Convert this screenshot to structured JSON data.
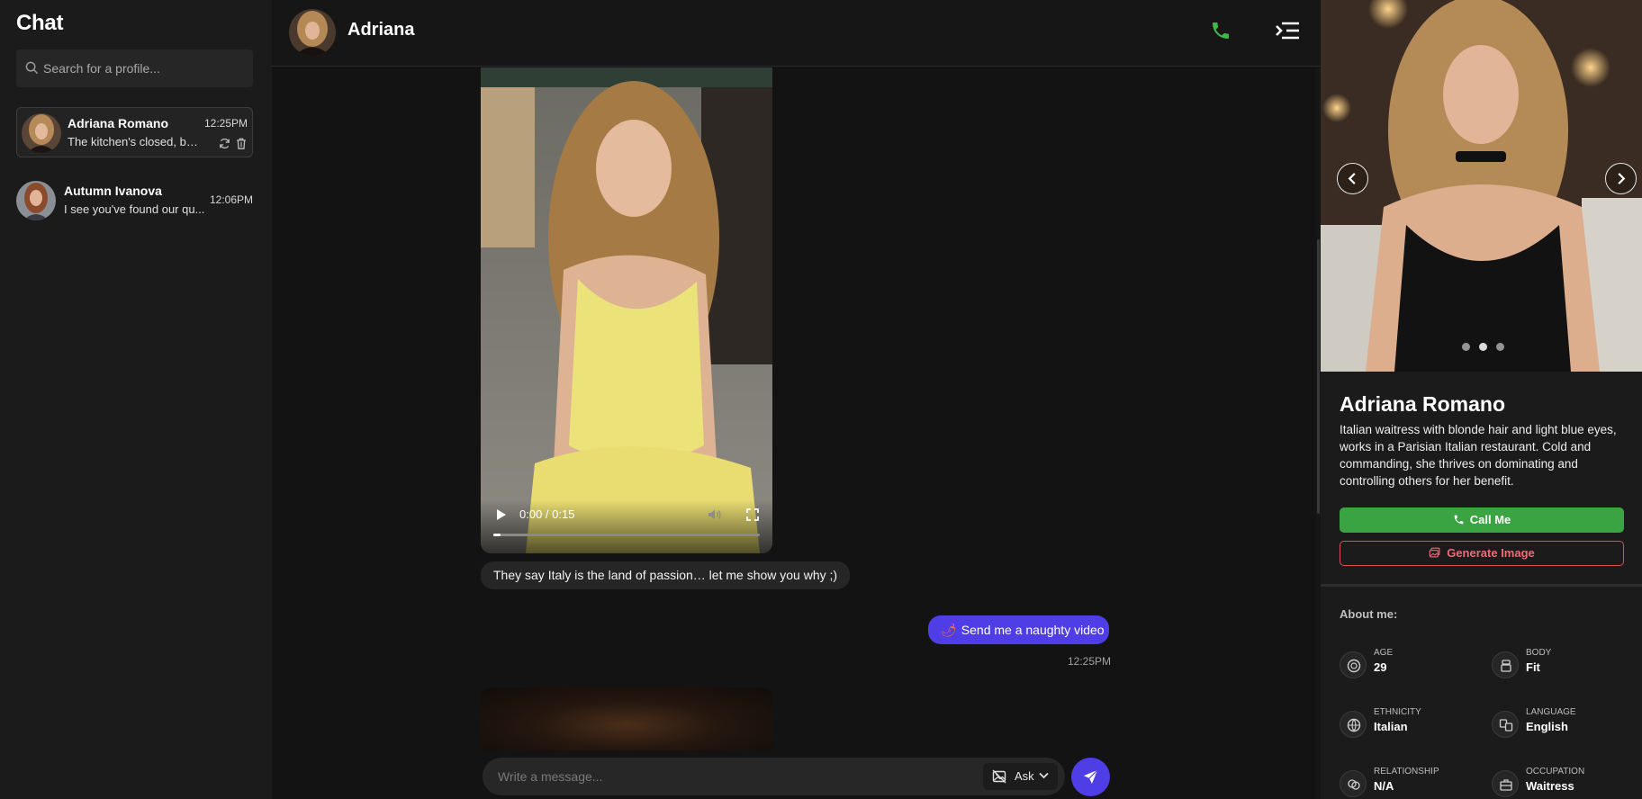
{
  "sidebar": {
    "title": "Chat",
    "search_placeholder": "Search for a profile...",
    "conversations": [
      {
        "name": "Adriana Romano",
        "time": "12:25PM",
        "snippet": "The kitchen's closed, but...",
        "active": true
      },
      {
        "name": "Autumn Ivanova",
        "time": "12:06PM",
        "snippet": "I see you've found our qu...",
        "active": false
      }
    ]
  },
  "header": {
    "name": "Adriana"
  },
  "messages": {
    "video_time": "0:00 / 0:15",
    "incoming_text": "They say Italy is the land of passion… let me show you why ;)",
    "outgoing_emoji": "🌶",
    "outgoing_text": "Send me a naughty video",
    "outgoing_time": "12:25PM"
  },
  "composer": {
    "placeholder": "Write a message...",
    "ask_label": "Ask"
  },
  "profile": {
    "name": "Adriana Romano",
    "description": "Italian waitress with blonde hair and light blue eyes, works in a Parisian Italian restaurant. Cold and commanding, she thrives on dominating and controlling others for her benefit.",
    "call_label": "Call Me",
    "generate_label": "Generate Image",
    "about_title": "About me:",
    "attributes": [
      {
        "key": "AGE",
        "value": "29"
      },
      {
        "key": "BODY",
        "value": "Fit"
      },
      {
        "key": "ETHNICITY",
        "value": "Italian"
      },
      {
        "key": "LANGUAGE",
        "value": "English"
      },
      {
        "key": "RELATIONSHIP",
        "value": "N/A"
      },
      {
        "key": "OCCUPATION",
        "value": "Waitress"
      }
    ]
  },
  "colors": {
    "accent": "#4f3ee6",
    "call_green": "#3aa443",
    "generate_red": "#e14b5a",
    "phone_icon": "#3db84a"
  },
  "icons": [
    "search-icon",
    "refresh-icon",
    "trash-icon",
    "phone-icon",
    "menu-collapse-icon",
    "play-icon",
    "mute-icon",
    "fullscreen-icon",
    "image-off-icon",
    "chevron-down-icon",
    "send-icon",
    "chevron-left-icon",
    "chevron-right-icon"
  ]
}
